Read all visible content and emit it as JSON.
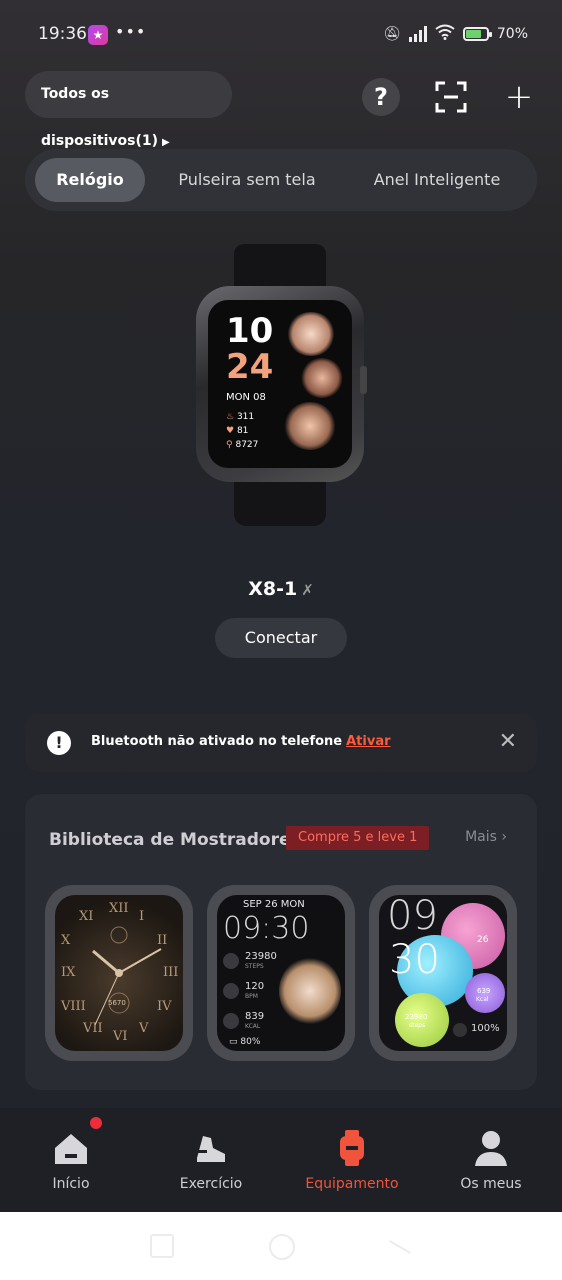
{
  "status_bar": {
    "time": "19:36",
    "dots": "•••",
    "battery": "70%"
  },
  "header": {
    "device_selector": "Todos os dispositivos(1)",
    "help": "?",
    "add": "+"
  },
  "tabs": [
    {
      "label": "Relógio",
      "active": true
    },
    {
      "label": "Pulseira sem tela",
      "active": false
    },
    {
      "label": "Anel Inteligente",
      "active": false
    }
  ],
  "watch_face": {
    "hour": "10",
    "minute": "24",
    "date": "MON 08",
    "calories": "311",
    "heart": "81",
    "steps": "8727"
  },
  "device": {
    "name": "X8-1",
    "connect_label": "Conectar"
  },
  "banner": {
    "message": "Bluetooth não ativado no telefone",
    "action": "Ativar"
  },
  "library": {
    "title": "Biblioteca de Mostradores",
    "promo": "Compre 5 e leve 1",
    "more": "Mais",
    "face1": {
      "numerals": [
        "XII",
        "III",
        "VI",
        "IX",
        "I",
        "II",
        "IV",
        "V",
        "VII",
        "VIII",
        "X",
        "XI"
      ],
      "value": "5670"
    },
    "face2": {
      "date": "SEP 26 MON",
      "time": "09:30",
      "steps": "23980",
      "steps_unit": "STEPS",
      "bpm": "120",
      "bpm_unit": "BPM",
      "kcal": "839",
      "kcal_unit": "KCAL",
      "battery": "80%"
    },
    "face3": {
      "hour": "09",
      "minute": "30",
      "day": "26",
      "steps": "23980",
      "steps_unit": "steps",
      "kcal": "639",
      "kcal_unit": "Kcal",
      "battery": "100%"
    }
  },
  "nav": [
    {
      "label": "Início",
      "icon": "home-icon"
    },
    {
      "label": "Exercício",
      "icon": "running-shoe-icon"
    },
    {
      "label": "Equipamento",
      "icon": "watch-icon",
      "active": true
    },
    {
      "label": "Os meus",
      "icon": "person-icon"
    }
  ],
  "colors": {
    "accent": "#f0543c",
    "background": "#23252c",
    "promo": "#7c1f24"
  }
}
